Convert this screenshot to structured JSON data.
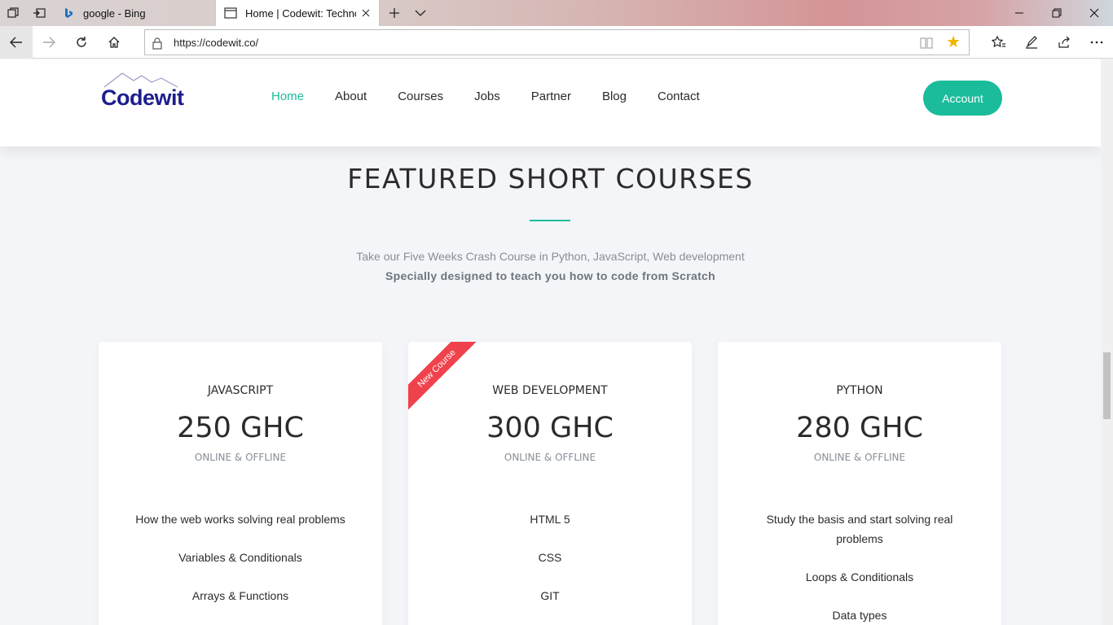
{
  "browser": {
    "tabs": [
      {
        "title": "google - Bing"
      },
      {
        "title": "Home | Codewit: Technology"
      }
    ],
    "url": "https://codewit.co/"
  },
  "site": {
    "logo_text": "Codewit",
    "nav": [
      "Home",
      "About",
      "Courses",
      "Jobs",
      "Partner",
      "Blog",
      "Contact"
    ],
    "account_label": "Account"
  },
  "section": {
    "title": "FEATURED SHORT COURSES",
    "subtitle": "Take our Five Weeks Crash Course in Python, JavaScript, Web development",
    "tagline": "Specially designed to teach you how to code from Scratch"
  },
  "courses": [
    {
      "name": "JAVASCRIPT",
      "price": "250 GHC",
      "mode": "ONLINE & OFFLINE",
      "topics": [
        "How the web works solving real problems",
        "Variables & Conditionals",
        "Arrays & Functions"
      ]
    },
    {
      "name": "WEB DEVELOPMENT",
      "price": "300 GHC",
      "mode": "ONLINE & OFFLINE",
      "ribbon": "New Course",
      "topics": [
        "HTML 5",
        "CSS",
        "GIT"
      ]
    },
    {
      "name": "PYTHON",
      "price": "280 GHC",
      "mode": "ONLINE & OFFLINE",
      "topics": [
        "Study the basis and start solving real problems",
        "Loops & Conditionals",
        "Data types"
      ]
    }
  ],
  "colors": {
    "accent": "#1bbc9b",
    "logo": "#1d1d8f",
    "ribbon": "#f0424c",
    "background": "#f4f5f9"
  }
}
